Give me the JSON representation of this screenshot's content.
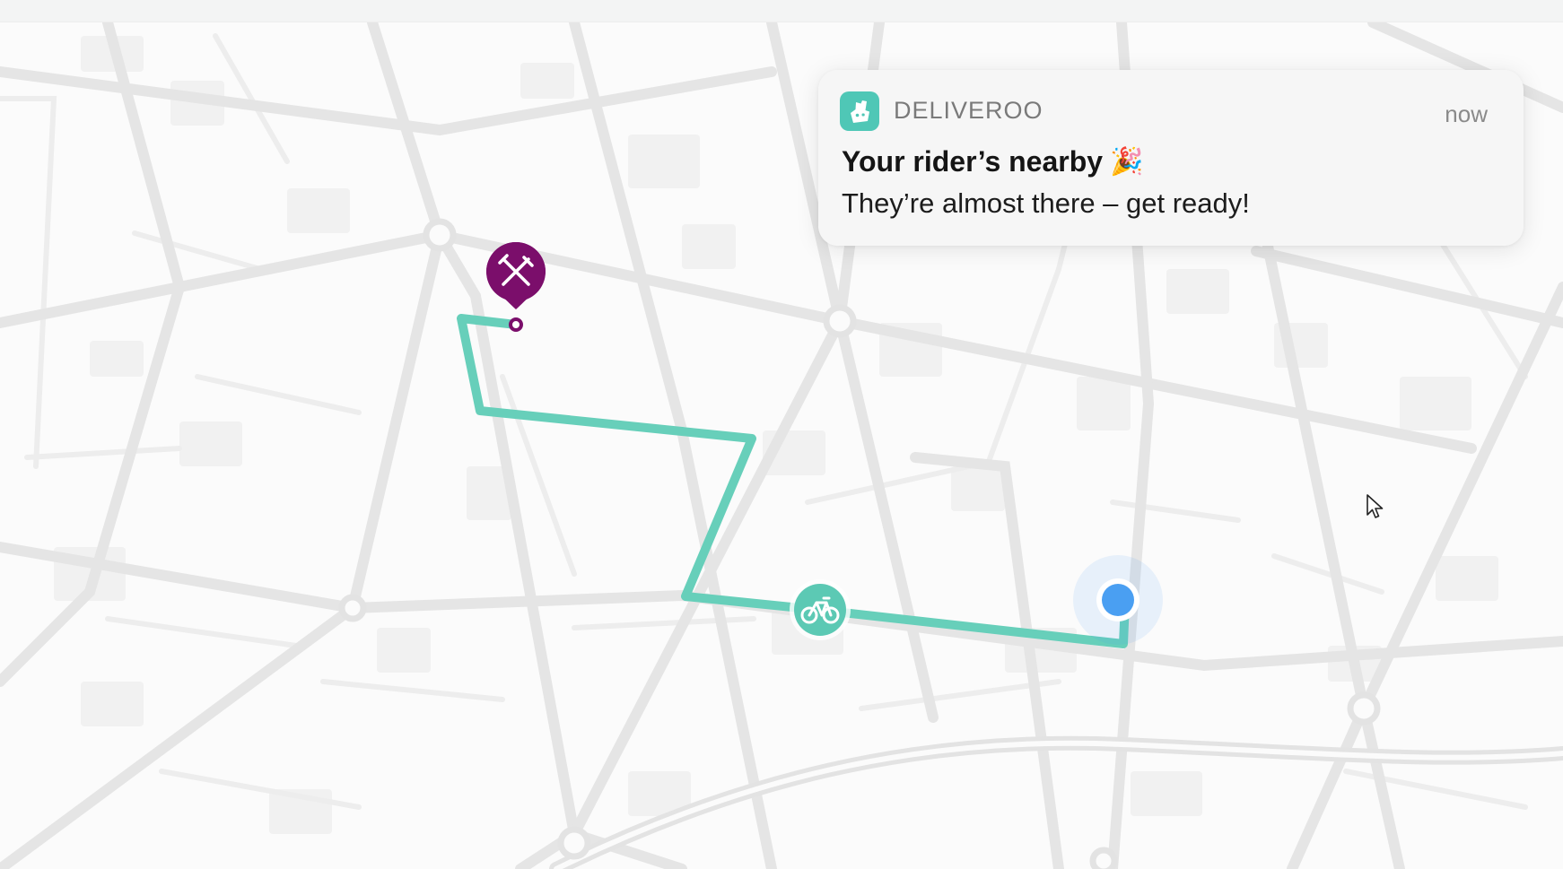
{
  "notification": {
    "app_name": "DELIVEROO",
    "time": "now",
    "title": "Your rider’s nearby",
    "title_emoji": "🎉",
    "body": "They’re almost there – get ready!",
    "icon": "deliveroo-logo-icon"
  },
  "map": {
    "markers": {
      "restaurant": {
        "icon": "fork-knife-icon",
        "color": "#7b0e6b"
      },
      "rider": {
        "icon": "bicycle-icon",
        "color": "#5cc9b4"
      },
      "destination": {
        "icon": "location-dot-icon",
        "color": "#4a9ff2"
      }
    },
    "route_color": "#67cfba",
    "road_color": "#e8e8e8",
    "block_color": "#efefef"
  },
  "colors": {
    "brand": "#4fc7b6",
    "background": "#fbfbfb"
  }
}
